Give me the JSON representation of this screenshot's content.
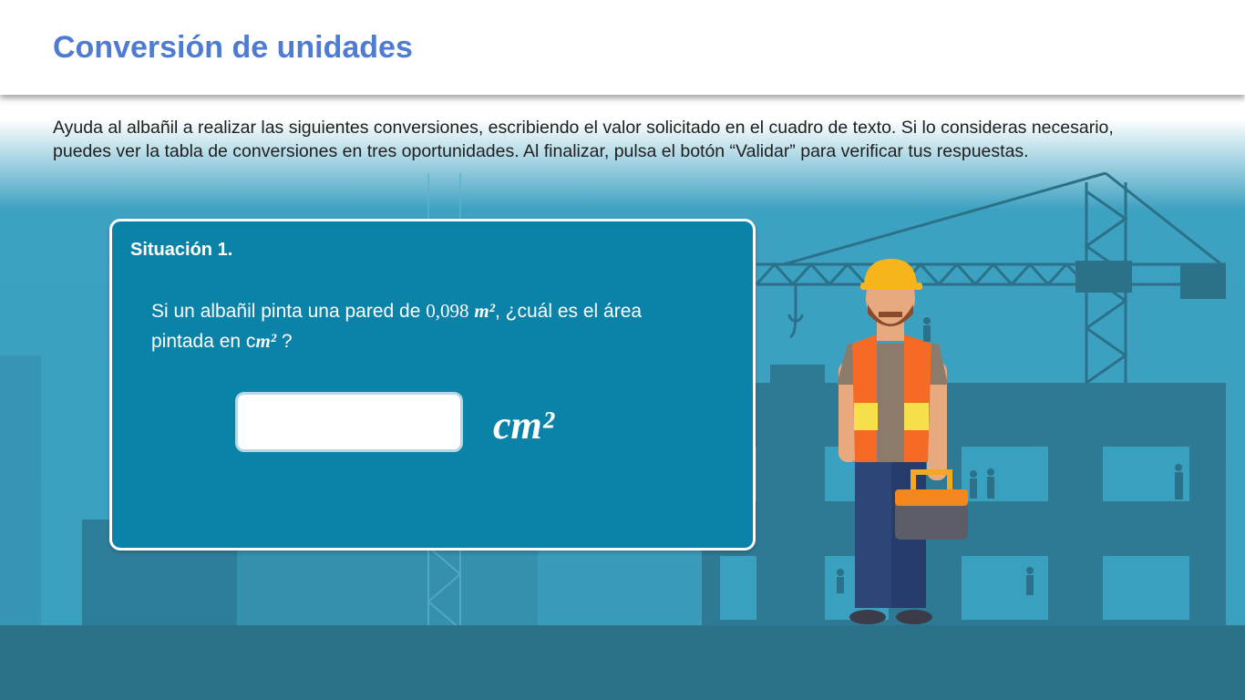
{
  "header": {
    "title": "Conversión de unidades"
  },
  "instructions": "Ayuda al albañil a realizar las siguientes conversiones, escribiendo el valor solicitado en el cuadro de texto. Si lo consideras necesario, puedes ver la tabla de conversiones en tres oportunidades. Al finalizar, pulsa el botón “Validar” para verificar tus respuestas.",
  "card": {
    "title": "Situación 1.",
    "question": {
      "part1": "Si un albañil pinta una pared de ",
      "value": "0,098",
      "unit_from": "m²",
      "part2": ", ¿cuál es el área pintada en c",
      "unit_to": "m²",
      "part3": " ?"
    },
    "answer": {
      "value": "",
      "placeholder": ""
    },
    "answer_unit": "cm²"
  },
  "colors": {
    "title": "#4f7bd1",
    "card": "#0b83a9",
    "background": "#3aa0c0",
    "ground": "#2a7189",
    "buildings": "#2e7a94"
  },
  "illustrations": [
    "construction-site-background",
    "tower-crane-icon",
    "construction-worker-illustration",
    "toolbox-icon"
  ]
}
